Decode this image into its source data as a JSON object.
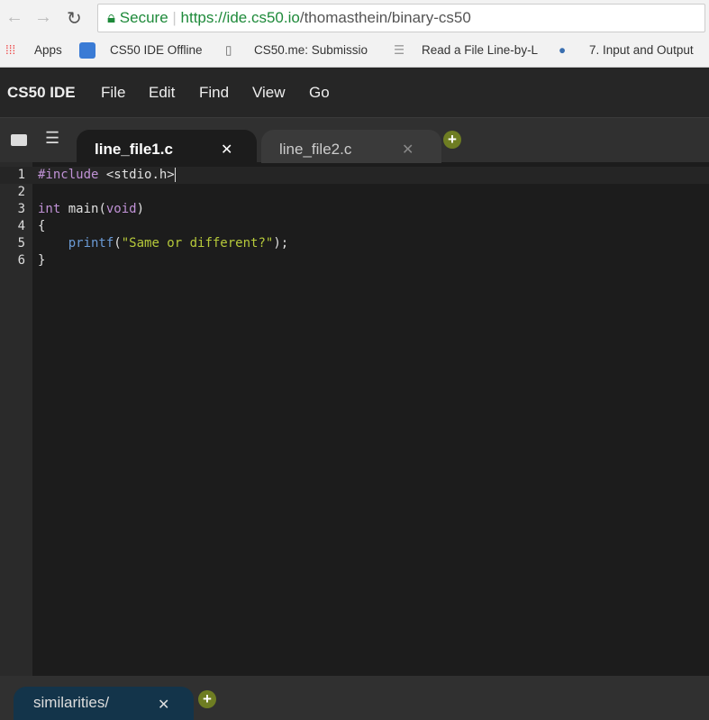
{
  "browser": {
    "secure_label": "Secure",
    "url_host": "https://ide.cs50.io",
    "url_path": "/thomasthein/binary-cs50",
    "bookmarks": [
      {
        "label": "Apps",
        "icon": "apps-grid-icon"
      },
      {
        "label": "CS50 IDE Offline",
        "icon": "cloud-icon"
      },
      {
        "label": "CS50.me: Submissio",
        "icon": "document-icon"
      },
      {
        "label": "Read a File Line-by-L",
        "icon": "list-icon"
      },
      {
        "label": "7. Input and Output",
        "icon": "python-icon"
      }
    ]
  },
  "menu": {
    "brand": "CS50 IDE",
    "items": [
      "File",
      "Edit",
      "Find",
      "View",
      "Go"
    ]
  },
  "tabs": [
    {
      "label": "line_file1.c",
      "active": true
    },
    {
      "label": "line_file2.c",
      "active": false
    }
  ],
  "code": {
    "lines": [
      "1",
      "2",
      "3",
      "4",
      "5",
      "6"
    ]
  },
  "bottom": {
    "tab_label": "similarities/"
  },
  "colors": {
    "accent": "#6e7d22",
    "keyword": "#c092d6",
    "string": "#b6c93a",
    "function": "#6b9bd6"
  }
}
